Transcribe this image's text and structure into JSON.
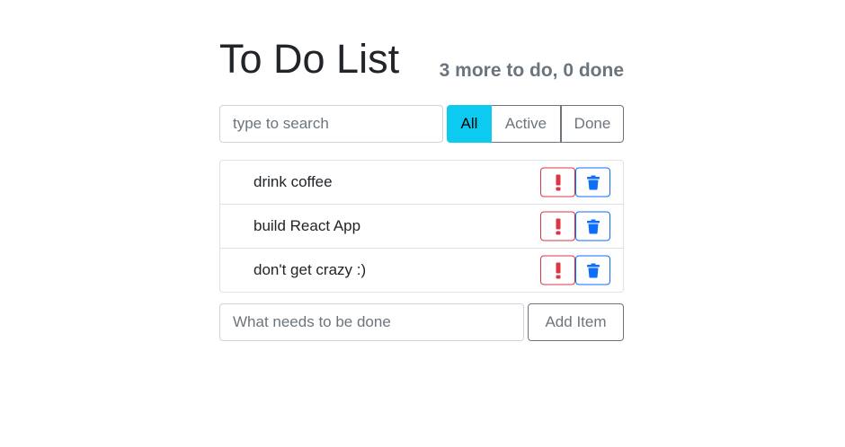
{
  "header": {
    "title": "To Do List",
    "counter": "3 more to do, 0 done"
  },
  "search": {
    "placeholder": "type to search",
    "value": ""
  },
  "filters": [
    {
      "label": "All",
      "selected": true
    },
    {
      "label": "Active",
      "selected": false
    },
    {
      "label": "Done",
      "selected": false
    }
  ],
  "todos": [
    {
      "label": "drink coffee",
      "important_icon": "exclamation-icon",
      "delete_icon": "trash-icon"
    },
    {
      "label": "build React App",
      "important_icon": "exclamation-icon",
      "delete_icon": "trash-icon"
    },
    {
      "label": "don't get crazy :)",
      "important_icon": "exclamation-icon",
      "delete_icon": "trash-icon"
    }
  ],
  "add_form": {
    "placeholder": "What needs to be done",
    "value": "",
    "button_label": "Add Item"
  },
  "colors": {
    "accent_filter": "#0dcaf0",
    "important": "#dc3545",
    "delete": "#0d6efd",
    "muted": "#6c757d"
  }
}
